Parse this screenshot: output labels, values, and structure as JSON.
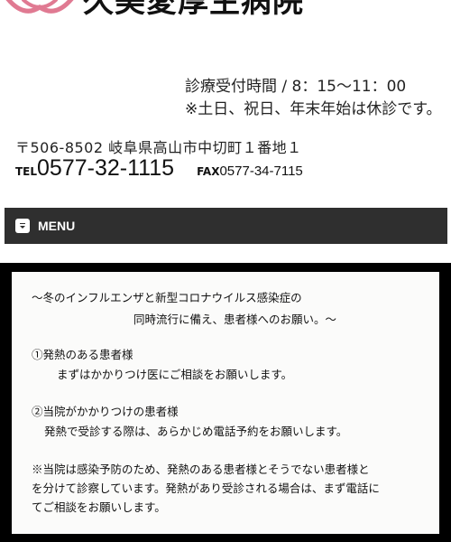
{
  "header": {
    "hospital_name": "久美愛厚生病院",
    "logo": "lotus-logo"
  },
  "hours": {
    "line1": "診療受付時間 / 8：15〜11：00",
    "line2": "※土日、祝日、年末年始は休診です。"
  },
  "contact": {
    "address": "〒506-8502 岐阜県高山市中切町１番地１",
    "tel_label": "TEL",
    "tel": "0577-32-1115",
    "fax_label": "FAX",
    "fax": "0577-34-7115"
  },
  "nav": {
    "menu_label": "MENU",
    "menu_icon": "menu-toggle-icon"
  },
  "notice": {
    "title_line1": "〜冬のインフルエンザと新型コロナウイルス感染症の",
    "title_line2": "同時流行に備え、患者様へのお願い。〜",
    "item1_heading": "①発熱のある患者様",
    "item1_body": "まずはかかりつけ医にご相談をお願いします。",
    "item2_heading": "②当院がかかりつけの患者様",
    "item2_body": "発熱で受診する際は、あらかじめ電話予約をお願いします。",
    "note_line1": "※当院は感染予防のため、発熱のある患者様とそうでない患者様と",
    "note_line2": "を分けて診察しています。発熱があり受診される場合は、まず電話に",
    "note_line3": "てご相談をお願いします。"
  },
  "colors": {
    "logo_pink": "#e07a92",
    "menu_bg": "#2f2f2f",
    "notice_frame": "#000000"
  }
}
